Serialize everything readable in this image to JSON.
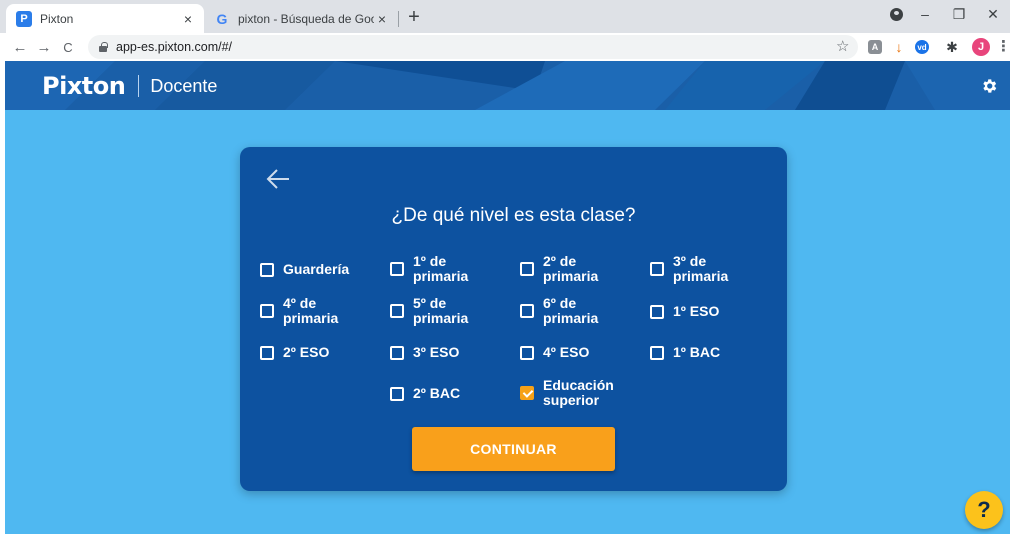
{
  "browser": {
    "tabs": [
      {
        "title": "Pixton",
        "favicon": "pixton-favicon",
        "active": true
      },
      {
        "title": "pixton - Búsqueda de Google",
        "favicon": "google-favicon",
        "active": false
      }
    ],
    "close_glyph": "×",
    "new_tab_glyph": "+",
    "url": "app-es.pixton.com/#/",
    "window_controls": {
      "minimize": "–",
      "restore": "❐",
      "close": "✕"
    },
    "nav": {
      "back": "←",
      "forward": "→",
      "reload": "C"
    },
    "star": "☆",
    "avatar_initial": "J",
    "menu": "⋮",
    "extensions": [
      {
        "name": "pdf-extension-icon",
        "glyph": "A",
        "color": "#8a8f95"
      },
      {
        "name": "download-extension-icon",
        "glyph": "↓",
        "color": "#e8710a"
      },
      {
        "name": "vd-extension-icon",
        "glyph": "vd",
        "color": "#1a73e8"
      },
      {
        "name": "puzzle-extension-icon",
        "glyph": "✱",
        "color": "#3c4043"
      }
    ]
  },
  "header": {
    "logo": "Pixton",
    "subtitle": "Docente",
    "settings_icon": "gear-icon"
  },
  "dialog": {
    "back_icon": "arrow-left-icon",
    "question": "¿De qué nivel es esta clase?",
    "options": [
      {
        "label": "Guardería",
        "checked": false
      },
      {
        "label": "1º de\nprimaria",
        "checked": false
      },
      {
        "label": "2º de\nprimaria",
        "checked": false
      },
      {
        "label": "3º de\nprimaria",
        "checked": false
      },
      {
        "label": "4º de\nprimaria",
        "checked": false
      },
      {
        "label": "5º de\nprimaria",
        "checked": false
      },
      {
        "label": "6º de\nprimaria",
        "checked": false
      },
      {
        "label": "1º ESO",
        "checked": false
      },
      {
        "label": "2º ESO",
        "checked": false
      },
      {
        "label": "3º ESO",
        "checked": false
      },
      {
        "label": "4º ESO",
        "checked": false
      },
      {
        "label": "1º BAC",
        "checked": false
      },
      {
        "label": "2º BAC",
        "checked": false
      },
      {
        "label": "Educación\nsuperior",
        "checked": true
      }
    ],
    "continue_label": "CONTINUAR"
  },
  "help": {
    "label": "?"
  },
  "colors": {
    "page_bg": "#4fb8f1",
    "header_bg": "#1a5fa8",
    "card_bg": "#0d52a0",
    "accent": "#f9a01b",
    "help_bg": "#fcc21b"
  }
}
